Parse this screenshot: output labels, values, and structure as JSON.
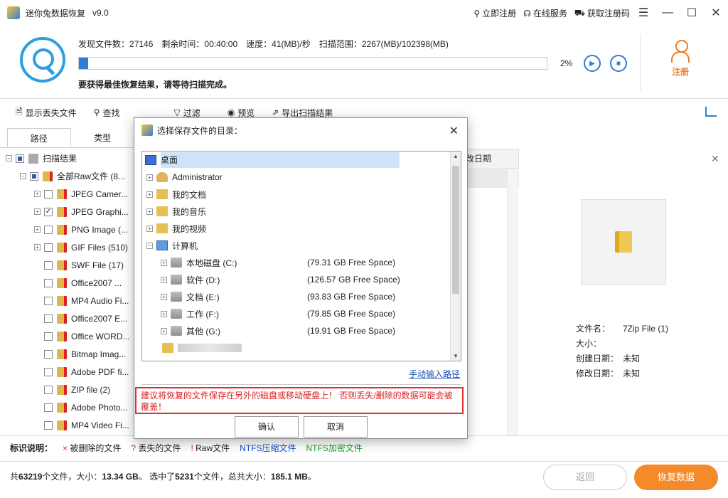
{
  "app": {
    "title": "迷你兔数据恢复",
    "version": "v9.0"
  },
  "title_links": {
    "register": "立即注册",
    "online": "在线服务",
    "getcode": "获取注册码"
  },
  "scan": {
    "found_label": "发现文件数：",
    "found": "27146",
    "remain_label": "剩余时间：",
    "remain": "00:40:00",
    "speed_label": "速度：",
    "speed": "41(MB)/秒",
    "range_label": "扫描范围：",
    "range": "2267(MB)/102398(MB)",
    "progress_fraction": 0.02,
    "percent": "2%",
    "hint": "要获得最佳恢复结果，请等待扫描完成。"
  },
  "register_label": "注册",
  "toolbar": {
    "show_lost": "显示丢失文件",
    "find": "查找",
    "filter": "过滤",
    "preview": "预览",
    "export": "导出扫描结果"
  },
  "tabs": {
    "path": "路径",
    "type": "类型"
  },
  "tree": [
    {
      "label": "扫描结果",
      "level": 0,
      "expander": "⊟",
      "check": "partial",
      "icon": "drive"
    },
    {
      "label": "全部Raw文件 (8...",
      "level": 1,
      "expander": "⊟",
      "check": "partial",
      "icon": "raw"
    },
    {
      "label": "JPEG Camer...",
      "level": 2,
      "expander": "⊞",
      "check": ""
    },
    {
      "label": "JPEG Graphi...",
      "level": 2,
      "expander": "⊞",
      "check": "✓"
    },
    {
      "label": "PNG Image (...",
      "level": 2,
      "expander": "⊞",
      "check": ""
    },
    {
      "label": "GIF Files (510)",
      "level": 2,
      "expander": "⊞",
      "check": ""
    },
    {
      "label": "SWF File (17)",
      "level": 2,
      "expander": "",
      "check": ""
    },
    {
      "label": "Office2007 ...",
      "level": 2,
      "expander": "",
      "check": ""
    },
    {
      "label": "MP4 Audio Fi...",
      "level": 2,
      "expander": "",
      "check": ""
    },
    {
      "label": "Office2007 E...",
      "level": 2,
      "expander": "",
      "check": ""
    },
    {
      "label": "Office WORD...",
      "level": 2,
      "expander": "",
      "check": ""
    },
    {
      "label": "Bitmap Imag...",
      "level": 2,
      "expander": "",
      "check": ""
    },
    {
      "label": "Adobe PDF fi...",
      "level": 2,
      "expander": "",
      "check": ""
    },
    {
      "label": "ZIP file (2)",
      "level": 2,
      "expander": "",
      "check": ""
    },
    {
      "label": "Adobe Photo...",
      "level": 2,
      "expander": "",
      "check": ""
    },
    {
      "label": "MP4 Video Fi...",
      "level": 2,
      "expander": "",
      "check": ""
    }
  ],
  "column_header": "改日期",
  "preview": {
    "name_label": "文件名：",
    "name": "7Zip File (1)",
    "size_label": "大小：",
    "size": "",
    "created_label": "创建日期：",
    "created": "未知",
    "modified_label": "修改日期：",
    "modified": "未知"
  },
  "legend": {
    "title": "标识说明：",
    "deleted_mark": "×",
    "deleted": "被删除的文件",
    "lost_mark": "?",
    "lost": "丢失的文件",
    "raw_mark": "!",
    "raw": "Raw文件",
    "ntfs_comp": "NTFS压缩文件",
    "ntfs_enc": "NTFS加密文件"
  },
  "summary": {
    "prefix": "共",
    "count": "63219",
    "mid1": "个文件，大小：",
    "size": "13.34 GB",
    "mid2": "。 选中了",
    "sel": "5231",
    "mid3": "个文件，总共大小：",
    "selsize": "185.1 MB",
    "end": "。"
  },
  "buttons": {
    "back": "返回",
    "recover": "恢复数据"
  },
  "dialog": {
    "title": "选择保存文件的目录：",
    "items": [
      {
        "label": "桌面",
        "icon": "desktop",
        "level": 0,
        "expander": "",
        "space": "",
        "selected": true
      },
      {
        "label": "Administrator",
        "icon": "user",
        "level": 1,
        "expander": "⊞",
        "space": ""
      },
      {
        "label": "我的文档",
        "icon": "folder",
        "level": 1,
        "expander": "⊞",
        "space": ""
      },
      {
        "label": "我的音乐",
        "icon": "folder",
        "level": 1,
        "expander": "⊞",
        "space": ""
      },
      {
        "label": "我的视频",
        "icon": "folder",
        "level": 1,
        "expander": "⊞",
        "space": ""
      },
      {
        "label": "计算机",
        "icon": "pc",
        "level": 1,
        "expander": "⊟",
        "space": ""
      },
      {
        "label": "本地磁盘 (C:)",
        "icon": "drive",
        "level": 2,
        "expander": "⊞",
        "space": "(79.31 GB Free Space)"
      },
      {
        "label": "软件 (D:)",
        "icon": "drive",
        "level": 2,
        "expander": "⊞",
        "space": "(126.57 GB Free Space)"
      },
      {
        "label": "文档 (E:)",
        "icon": "drive",
        "level": 2,
        "expander": "⊞",
        "space": "(93.83 GB Free Space)"
      },
      {
        "label": "工作 (F:)",
        "icon": "drive",
        "level": 2,
        "expander": "⊞",
        "space": "(79.85 GB Free Space)"
      },
      {
        "label": "其他 (G:)",
        "icon": "drive",
        "level": 2,
        "expander": "⊞",
        "space": "(19.91 GB Free Space)"
      }
    ],
    "manual": "手动输入路径",
    "warning": "建议将恢复的文件保存在另外的磁盘或移动硬盘上！ 否则丢失/删除的数据可能会被覆盖！",
    "ok": "确认",
    "cancel": "取消"
  }
}
